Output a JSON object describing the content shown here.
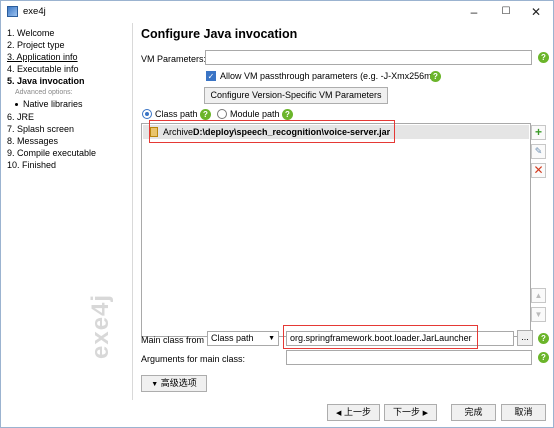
{
  "window": {
    "title": "exe4j",
    "minimize": "–",
    "maximize": "☐",
    "close": "✕"
  },
  "sidebar": {
    "steps": [
      {
        "label": "1. Welcome"
      },
      {
        "label": "2. Project type"
      },
      {
        "label": "3. Application info"
      },
      {
        "label": "4. Executable info"
      },
      {
        "label": "5. Java invocation"
      },
      {
        "label": "Advanced options:"
      },
      {
        "label": "Native libraries"
      },
      {
        "label": "6. JRE"
      },
      {
        "label": "7. Splash screen"
      },
      {
        "label": "8. Messages"
      },
      {
        "label": "9. Compile executable"
      },
      {
        "label": "10. Finished"
      }
    ],
    "watermark": "exe4j"
  },
  "main": {
    "title": "Configure Java invocation",
    "vm_parameters_label": "VM Parameters:",
    "vm_parameters_value": "",
    "allow_passthrough_label": "Allow VM passthrough parameters (e.g. -J-Xmx256m)",
    "allow_passthrough_checked": true,
    "configure_vm_button": "Configure Version-Specific VM Parameters",
    "classpath_radio": "Class path",
    "modulepath_radio": "Module path",
    "classpath_entries": [
      {
        "type": "Archive",
        "path": "D:\\deploy\\speech_recognition\\voice-server.jar"
      }
    ],
    "main_class_from_label": "Main class from",
    "main_class_source": "Class path",
    "main_class_value": "org.springframework.boot.loader.JarLauncher",
    "browse_button": "...",
    "arguments_label": "Arguments for main class:",
    "arguments_value": "",
    "advanced_button": "高级选项"
  },
  "footer": {
    "back_button": "上一步",
    "next_button": "下一步",
    "finish_button": "完成",
    "cancel_button": "取消"
  },
  "colors": {
    "help_icon": "#6bb52a",
    "highlight_box": "#e53935",
    "accent": "#3a74c5"
  }
}
